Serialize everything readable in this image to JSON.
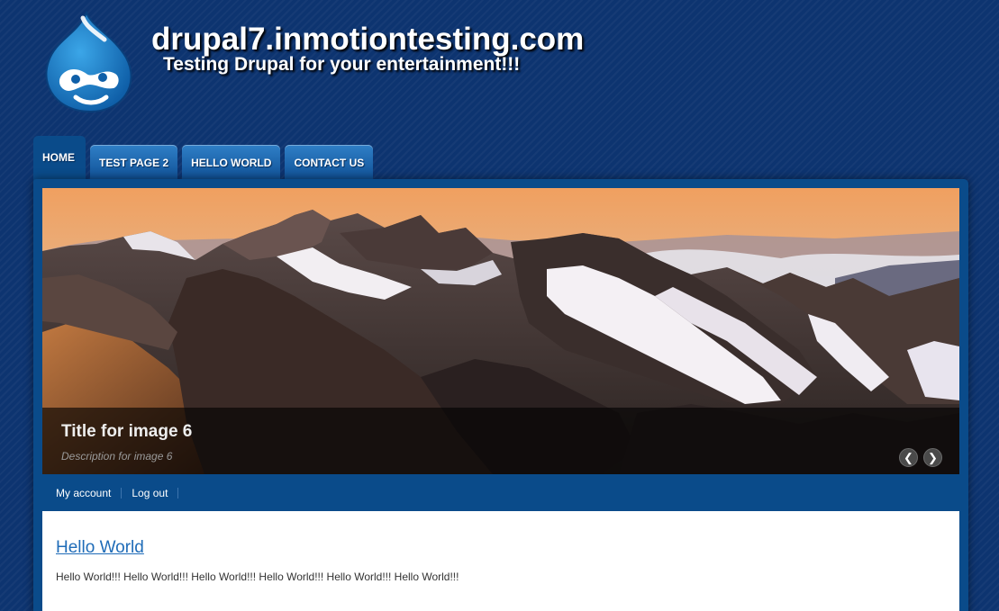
{
  "header": {
    "site_name": "drupal7.inmotiontesting.com",
    "site_slogan": "Testing Drupal for your entertainment!!!",
    "logo_icon": "drupal-drop-icon"
  },
  "nav": {
    "tabs": [
      {
        "label": "HOME",
        "active": true
      },
      {
        "label": "TEST PAGE 2",
        "active": false
      },
      {
        "label": "HELLO WORLD",
        "active": false
      },
      {
        "label": "CONTACT US",
        "active": false
      }
    ]
  },
  "slideshow": {
    "title": "Title for image 6",
    "description": "Description for image 6",
    "prev_icon": "chevron-left-icon",
    "next_icon": "chevron-right-icon",
    "prev_glyph": "❮",
    "next_glyph": "❯"
  },
  "secondary_menu": {
    "items": [
      {
        "label": "My account"
      },
      {
        "label": "Log out"
      }
    ]
  },
  "content": {
    "title": "Hello World",
    "body": "Hello World!!! Hello World!!! Hello World!!! Hello World!!! Hello World!!! Hello World!!!"
  },
  "colors": {
    "page_background": "#0d3470",
    "panel": "#0a4b8a",
    "tab": "#1f6bb3",
    "link": "#1f6cb8"
  }
}
